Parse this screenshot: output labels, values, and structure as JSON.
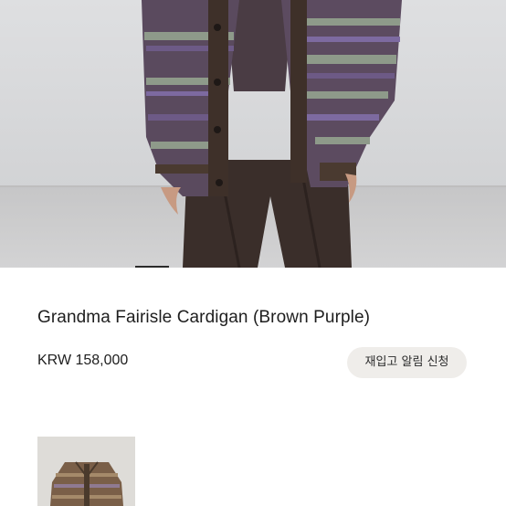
{
  "product": {
    "title": "Grandma Fairisle Cardigan (Brown Purple)",
    "price": "KRW 158,000",
    "restock_button_label": "재입고 알림 신청"
  },
  "gallery": {
    "hero_image": "product-photo-model-wearing-cardigan",
    "active_slide": 1,
    "thumbnail_image": "product-thumbnail-flat-lay"
  },
  "colors": {
    "background": "#ffffff",
    "button_bg": "#efedea",
    "text": "#1e1e1e"
  }
}
